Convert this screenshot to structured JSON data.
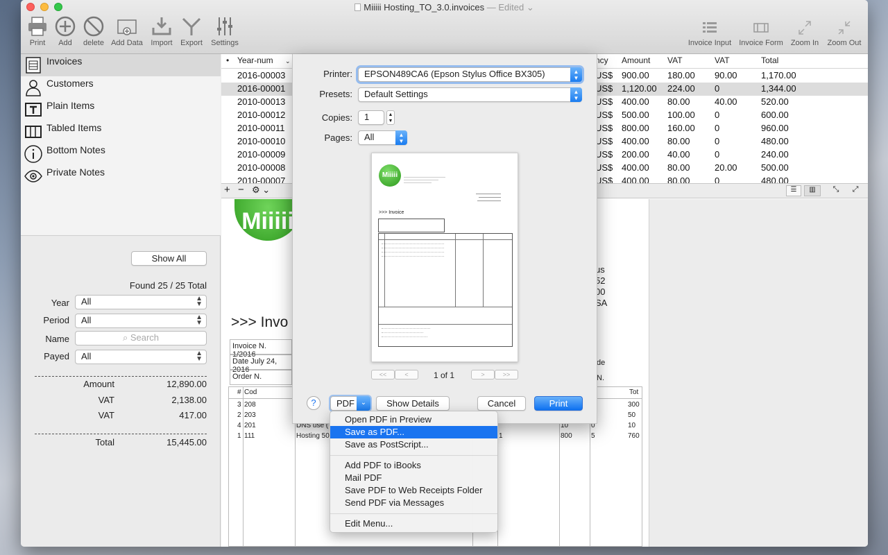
{
  "window": {
    "title": "Miiiii Hosting_TO_3.0.invoices",
    "status": "— Edited"
  },
  "toolbar": {
    "left": [
      {
        "label": "Print"
      },
      {
        "label": "Add"
      },
      {
        "label": "delete"
      },
      {
        "label": "Add Data"
      },
      {
        "label": "Import"
      },
      {
        "label": "Export"
      },
      {
        "label": "Settings"
      }
    ],
    "right": [
      {
        "label": "Invoice Input"
      },
      {
        "label": "Invoice Form"
      },
      {
        "label": "Zoom In"
      },
      {
        "label": "Zoom Out"
      }
    ]
  },
  "sidebar": {
    "items": [
      {
        "label": "Invoices",
        "icon": "invoice-icon"
      },
      {
        "label": "Customers",
        "icon": "customer-icon"
      },
      {
        "label": "Plain Items",
        "icon": "text-icon"
      },
      {
        "label": "Tabled Items",
        "icon": "table-icon"
      },
      {
        "label": "Bottom Notes",
        "icon": "info-icon"
      },
      {
        "label": "Private Notes",
        "icon": "eye-icon"
      }
    ],
    "show_all": "Show All",
    "found": "Found 25 / 25 Total",
    "filters": {
      "year_label": "Year",
      "year_value": "All",
      "period_label": "Period",
      "period_value": "All",
      "name_label": "Name",
      "name_placeholder": "Search",
      "payed_label": "Payed",
      "payed_value": "All"
    },
    "summary": [
      {
        "label": "Amount",
        "value": "12,890.00"
      },
      {
        "label": "VAT",
        "value": "2,138.00"
      },
      {
        "label": "VAT",
        "value": "417.00"
      }
    ],
    "total": {
      "label": "Total",
      "value": "15,445.00"
    }
  },
  "table": {
    "columns": [
      "•",
      "Year-num",
      "ncy",
      "Amount",
      "VAT",
      "VAT",
      "Total"
    ],
    "rows": [
      [
        "2016-00003",
        "US$",
        "900.00",
        "180.00",
        "90.00",
        "1,170.00"
      ],
      [
        "2016-00001",
        "US$",
        "1,120.00",
        "224.00",
        "0",
        "1,344.00"
      ],
      [
        "2010-00013",
        "US$",
        "400.00",
        "80.00",
        "40.00",
        "520.00"
      ],
      [
        "2010-00012",
        "US$",
        "500.00",
        "100.00",
        "0",
        "600.00"
      ],
      [
        "2010-00011",
        "US$",
        "800.00",
        "160.00",
        "0",
        "960.00"
      ],
      [
        "2010-00010",
        "US$",
        "400.00",
        "80.00",
        "0",
        "480.00"
      ],
      [
        "2010-00009",
        "US$",
        "200.00",
        "40.00",
        "0",
        "240.00"
      ],
      [
        "2010-00008",
        "US$",
        "400.00",
        "80.00",
        "20.00",
        "500.00"
      ],
      [
        "2010-00007",
        "US$",
        "400.00",
        "80.00",
        "0",
        "480.00"
      ]
    ],
    "selected_row": 1
  },
  "preview": {
    "logo": "Miiiii",
    "heading": ">>> Invo",
    "invoice_no": "Invoice N.  1/2016",
    "date": "Date July 24, 2016",
    "order": "Order N.",
    "right_frag": [
      "us",
      "52",
      "00",
      "SA"
    ],
    "right_frag2": [
      "de",
      "N."
    ],
    "items_header": {
      "n": "#",
      "code": "Cod",
      "tot": "Tot"
    },
    "items": [
      {
        "n": "3",
        "code": "208",
        "desc": "",
        "q": "",
        "p": "",
        "d": "",
        "tot": "300"
      },
      {
        "n": "2",
        "code": "203",
        "desc": "",
        "q": "",
        "p": "",
        "d": "",
        "tot": "50"
      },
      {
        "n": "4",
        "code": "201",
        "desc": "DNS use (",
        "q": "",
        "p": "10",
        "d": "0",
        "tot": "10"
      },
      {
        "n": "1",
        "code": "111",
        "desc": "Hosting 50",
        "q": "1",
        "p": "800",
        "d": "5",
        "tot": "760"
      }
    ]
  },
  "print": {
    "printer_label": "Printer:",
    "printer_value": "EPSON489CA6 (Epson Stylus Office BX305)",
    "presets_label": "Presets:",
    "presets_value": "Default Settings",
    "copies_label": "Copies:",
    "copies_value": "1",
    "pages_label": "Pages:",
    "pages_value": "All",
    "page_indicator": "1 of 1",
    "help": "?",
    "pdf": "PDF",
    "show_details": "Show Details",
    "cancel": "Cancel",
    "print": "Print",
    "thumb_logo": "Miiiii",
    "thumb_heading": ">>> Invoice"
  },
  "pdf_menu": {
    "group1": [
      "Open PDF in Preview",
      "Save as PDF...",
      "Save as PostScript..."
    ],
    "group2": [
      "Add PDF to iBooks",
      "Mail PDF",
      "Save PDF to Web Receipts Folder",
      "Send PDF via Messages"
    ],
    "group3": [
      "Edit Menu..."
    ],
    "highlighted": "Save as PDF..."
  }
}
